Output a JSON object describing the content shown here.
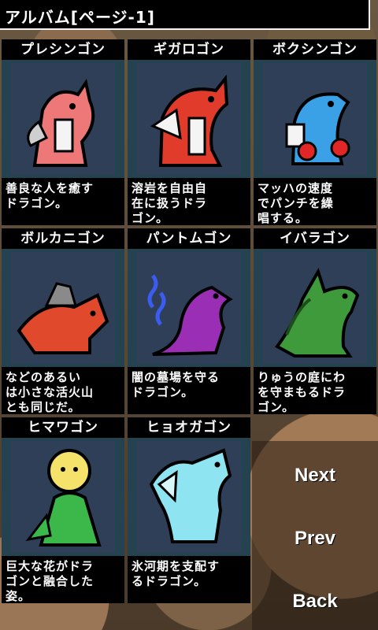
{
  "header": {
    "title": "アルバム[ページ-1]"
  },
  "cards": [
    {
      "name": "プレシンゴン",
      "desc": "善良な人を癒す\nドラゴン。",
      "color": "#ee7777"
    },
    {
      "name": "ギガロゴン",
      "desc": "溶岩を自由自\n在に扱うドラ\nゴン。",
      "color": "#e13b2c"
    },
    {
      "name": "ボクシンゴン",
      "desc": "マッハの速度\nでパンチを繰\n唱する。",
      "color": "#3aa1e6"
    },
    {
      "name": "ボルカニゴン",
      "desc": "などのあるい\nは小さな活火山\nとも同じだ。",
      "color": "#e0492c"
    },
    {
      "name": "パントムゴン",
      "desc": "闇の墓場を守る\nドラゴン。",
      "color": "#9a2fb5"
    },
    {
      "name": "イバラゴン",
      "desc": "りゅうの庭にわ\nを守まもるドラ\nゴン。",
      "color": "#3e9a3a"
    },
    {
      "name": "ヒマワゴン",
      "desc": "巨大な花がドラ\nゴンと融合した\n姿。",
      "color": "#3cb84a"
    },
    {
      "name": "ヒョオガゴン",
      "desc": "氷河期を支配す\nるドラゴン。",
      "color": "#8fe4f2"
    }
  ],
  "menu": {
    "next": "Next",
    "prev": "Prev",
    "back": "Back"
  }
}
